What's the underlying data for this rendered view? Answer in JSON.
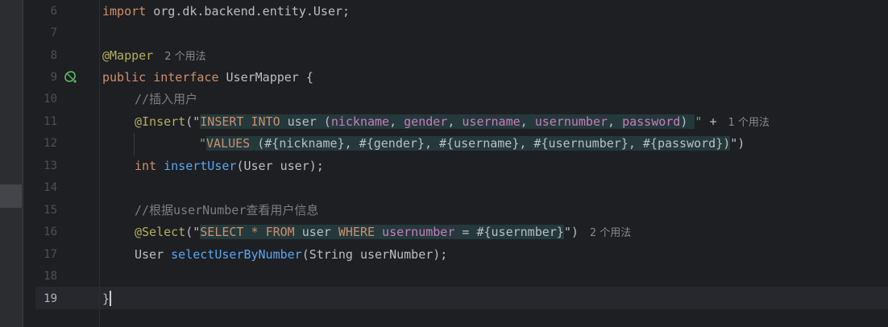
{
  "lines": [
    {
      "no": "6"
    },
    {
      "no": "7"
    },
    {
      "no": "8"
    },
    {
      "no": "9"
    },
    {
      "no": "10"
    },
    {
      "no": "11"
    },
    {
      "no": "12"
    },
    {
      "no": "13"
    },
    {
      "no": "14"
    },
    {
      "no": "15"
    },
    {
      "no": "16"
    },
    {
      "no": "17"
    },
    {
      "no": "18"
    },
    {
      "no": "19"
    }
  ],
  "code": {
    "l6_import": "import",
    "l6_path": " org.dk.backend.entity.User;",
    "l8_ann": "@Mapper",
    "l8_hint": "2 个用法",
    "l9_public": "public",
    "l9_interface": "interface",
    "l9_name": " UserMapper {",
    "l10_comment": "//插入用户",
    "l11_ann": "@Insert",
    "l11_open": "(\"",
    "l11_insert": "INSERT INTO",
    "l11_user": " user (",
    "l11_c1": "nickname",
    "l11_s1": ", ",
    "l11_c2": "gender",
    "l11_s2": ", ",
    "l11_c3": "username",
    "l11_s3": ", ",
    "l11_c4": "usernumber",
    "l11_s4": ", ",
    "l11_c5": "password",
    "l11_close": ") ",
    "l11_quote": "\"",
    "l11_plus": " +",
    "l11_hint": "1 个用法",
    "l12_quote": "\"",
    "l12_values": "VALUES",
    "l12_rest": " (#{nickname}, #{gender}, #{username}, #{usernumber}, #{password})",
    "l12_end": "\")",
    "l13_int": "int",
    "l13_fn": "insertUser",
    "l13_rest": "(User user);",
    "l15_comment": "//根据userNumber查看用户信息",
    "l16_ann": "@Select",
    "l16_open": "(\"",
    "l16_select": "SELECT",
    "l16_star": " * ",
    "l16_from": "FROM",
    "l16_user": " user ",
    "l16_where": "WHERE",
    "l16_col": " usernumber",
    "l16_rest": " = #{usernmber}",
    "l16_end": "\")",
    "l16_hint": "2 个用法",
    "l17_type": "User ",
    "l17_fn": "selectUserByNumber",
    "l17_rest": "(String userNumber);",
    "l19_brace": "}"
  },
  "colors": {
    "background": "#1e1f22",
    "keyword": "#cf8e6d",
    "annotation": "#b3ae60",
    "function": "#56a8f5",
    "string": "#6aab73",
    "column": "#c77dbb"
  }
}
